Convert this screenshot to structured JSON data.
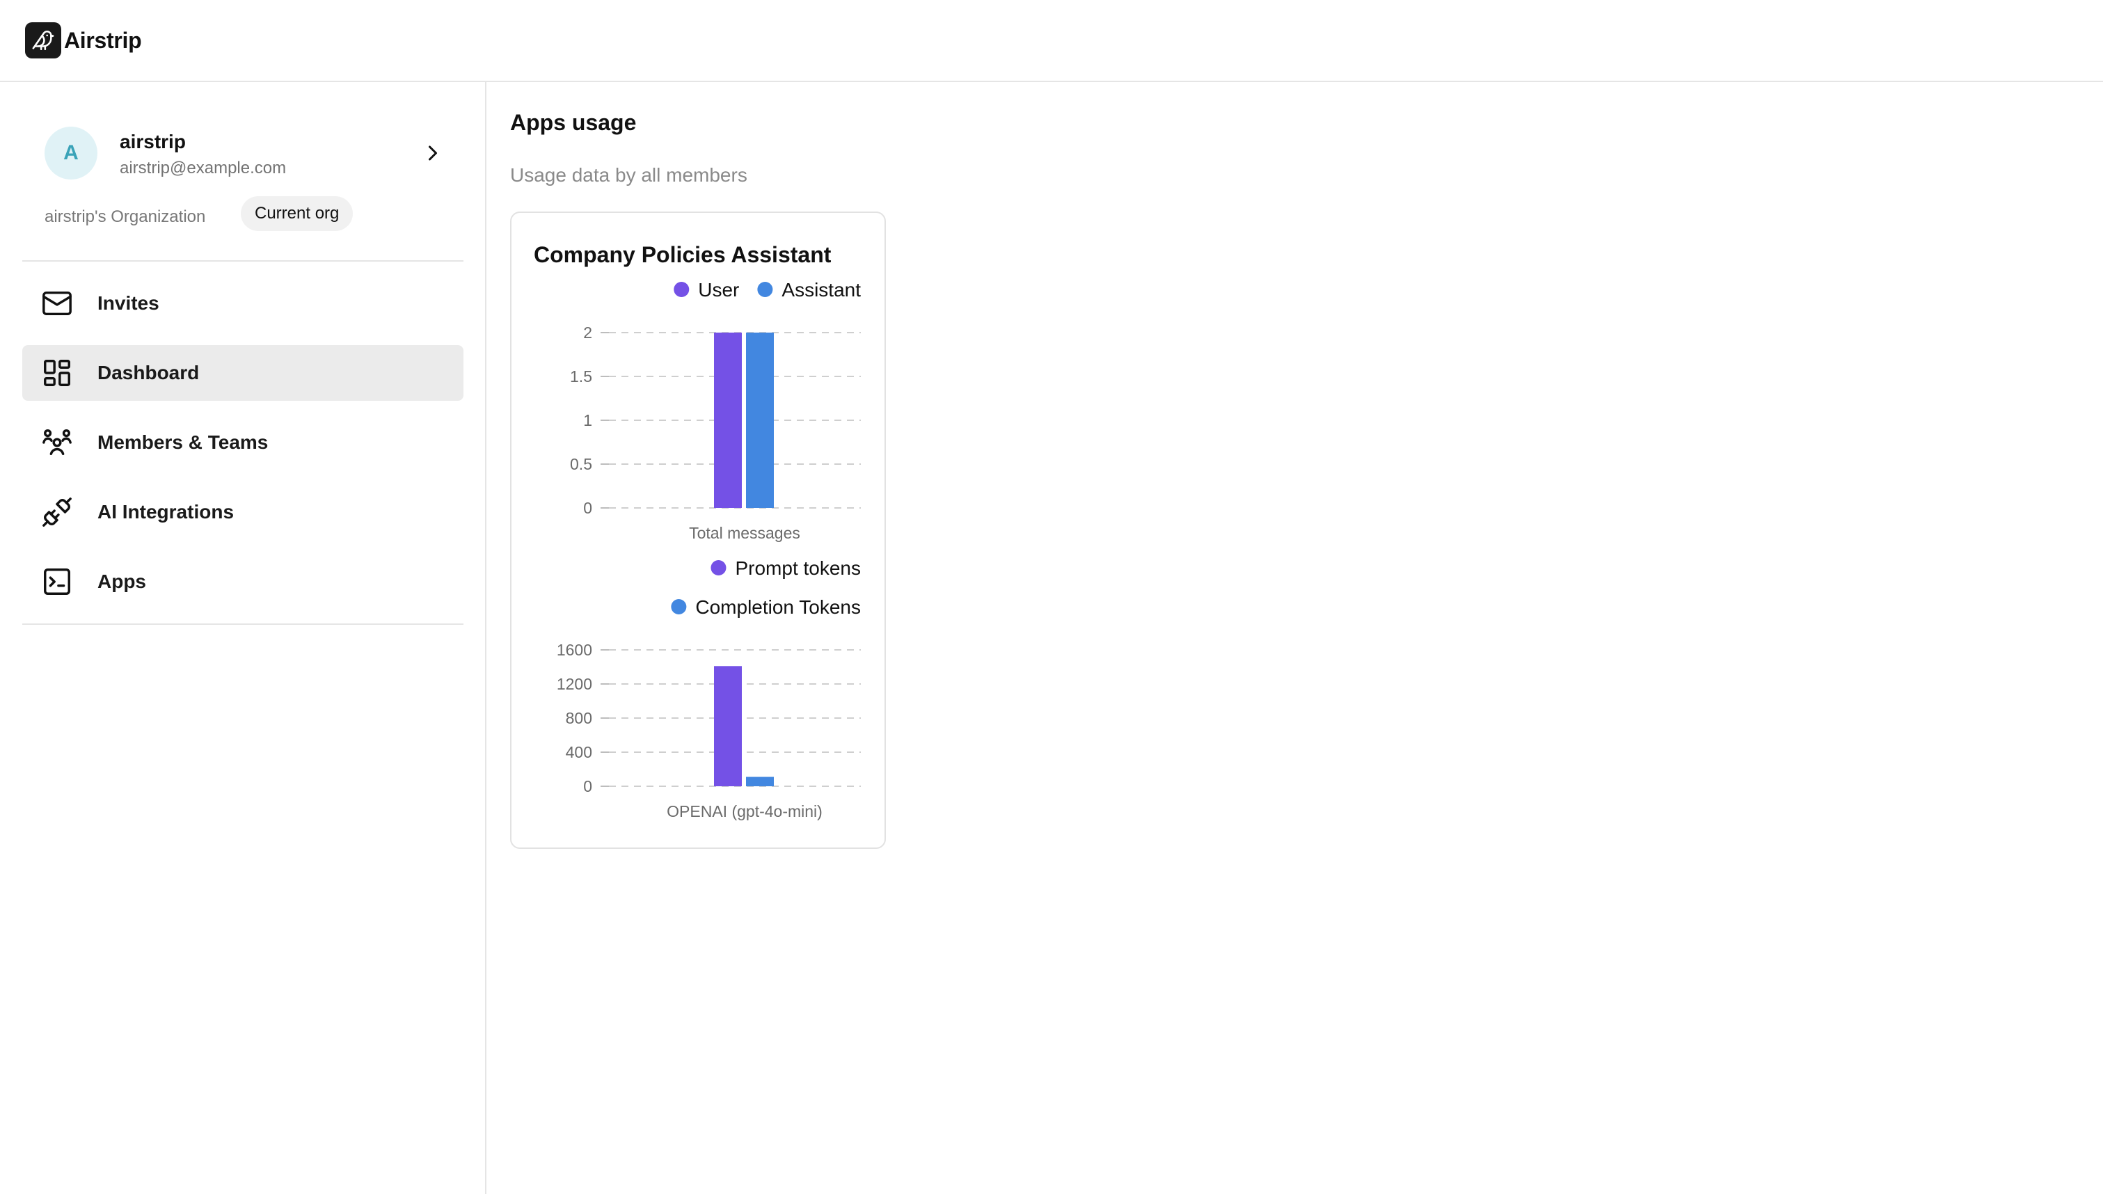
{
  "app": {
    "name": "Airstrip"
  },
  "org": {
    "avatar_letter": "A",
    "name": "airstrip",
    "email": "airstrip@example.com",
    "label": "airstrip's Organization",
    "badge": "Current org"
  },
  "nav": [
    {
      "label": "Invites",
      "icon": "mail-icon",
      "active": false
    },
    {
      "label": "Dashboard",
      "icon": "dashboard-icon",
      "active": true
    },
    {
      "label": "Members & Teams",
      "icon": "users-icon",
      "active": false
    },
    {
      "label": "AI Integrations",
      "icon": "plug-icon",
      "active": false
    },
    {
      "label": "Apps",
      "icon": "terminal-icon",
      "active": false
    }
  ],
  "page": {
    "title": "Apps usage",
    "subtitle": "Usage data by all members"
  },
  "colors": {
    "user": "#7451e6",
    "assistant": "#4287e0",
    "avatar_bg": "#e0f2f6",
    "avatar_text": "#3aa3b8",
    "active_nav": "#ebebeb"
  },
  "card": {
    "title": "Company Policies Assistant"
  },
  "chart_data": [
    {
      "type": "bar",
      "categories": [
        "Total messages"
      ],
      "series": [
        {
          "name": "User",
          "values": [
            2
          ]
        },
        {
          "name": "Assistant",
          "values": [
            2
          ]
        }
      ],
      "yticks": [
        "0",
        "0.5",
        "1",
        "1.5",
        "2"
      ],
      "ylim": [
        0,
        2
      ],
      "xlabel": "Total messages",
      "legend": "top-right",
      "grid": true
    },
    {
      "type": "bar",
      "categories": [
        "OPENAI (gpt-4o-mini)"
      ],
      "series": [
        {
          "name": "Prompt tokens",
          "values": [
            1410
          ]
        },
        {
          "name": "Completion Tokens",
          "values": [
            110
          ]
        }
      ],
      "yticks": [
        "0",
        "400",
        "800",
        "1200",
        "1600"
      ],
      "ylim": [
        0,
        1600
      ],
      "xlabel": "OPENAI (gpt-4o-mini)",
      "legend": "top-right",
      "grid": true
    }
  ]
}
